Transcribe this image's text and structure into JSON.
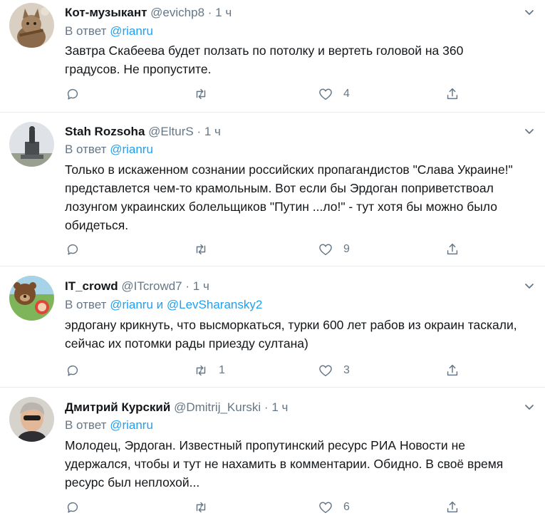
{
  "tweets": [
    {
      "name": "Кот-музыкант",
      "handle": "@evichp8",
      "dot": "·",
      "time": "1 ч",
      "reply_prefix": "В ответ",
      "reply_handle": "@rianru",
      "reply_and": "",
      "reply_handle2": "",
      "text": "Завтра Скабеева будет ползать по потолку и вертеть головой на 360 градусов. Не пропустите.",
      "retweets": "",
      "likes": "4",
      "avatar_icon": "cat-avatar"
    },
    {
      "name": "Stah Rozsoha",
      "handle": "@ElturS",
      "dot": "·",
      "time": "1 ч",
      "reply_prefix": "В ответ",
      "reply_handle": "@rianru",
      "reply_and": "",
      "reply_handle2": "",
      "text": "Только в искаженном сознании российских пропагандистов \"Слава Украине!\" представлется чем-то крамольным. Вот если бы Эрдоган поприветствоал лозунгом украинских болельщиков \"Путин ...ло!\" - тут хотя бы можно было обидеться.",
      "retweets": "",
      "likes": "9",
      "avatar_icon": "monument-avatar"
    },
    {
      "name": "IT_crowd",
      "handle": "@ITcrowd7",
      "dot": "·",
      "time": "1 ч",
      "reply_prefix": "В ответ",
      "reply_handle": "@rianru",
      "reply_and": "и",
      "reply_handle2": "@LevSharansky2",
      "text": "эрдогану крикнуть, что высморкаться, турки 600 лет рабов из окраин таскали, сейчас их потомки рады приезду султана)",
      "retweets": "1",
      "likes": "3",
      "avatar_icon": "bear-avatar"
    },
    {
      "name": "Дмитрий Курский",
      "handle": "@Dmitrij_Kurski",
      "dot": "·",
      "time": "1 ч",
      "reply_prefix": "В ответ",
      "reply_handle": "@rianru",
      "reply_and": "",
      "reply_handle2": "",
      "text": "Молодец, Эрдоган. Известный пропутинский ресурс РИА Новости не удержался, чтобы и тут не нахамить в комментарии. Обидно. В своё время ресурс был неплохой...",
      "retweets": "",
      "likes": "6",
      "avatar_icon": "person-avatar"
    }
  ],
  "icons": {
    "reply": "reply-icon",
    "retweet": "retweet-icon",
    "like": "like-icon",
    "share": "share-icon",
    "caret": "chevron-down-icon"
  },
  "colors": {
    "text": "#14171a",
    "secondary": "#657786",
    "link": "#1da1f2",
    "divider": "#e6ecf0"
  }
}
